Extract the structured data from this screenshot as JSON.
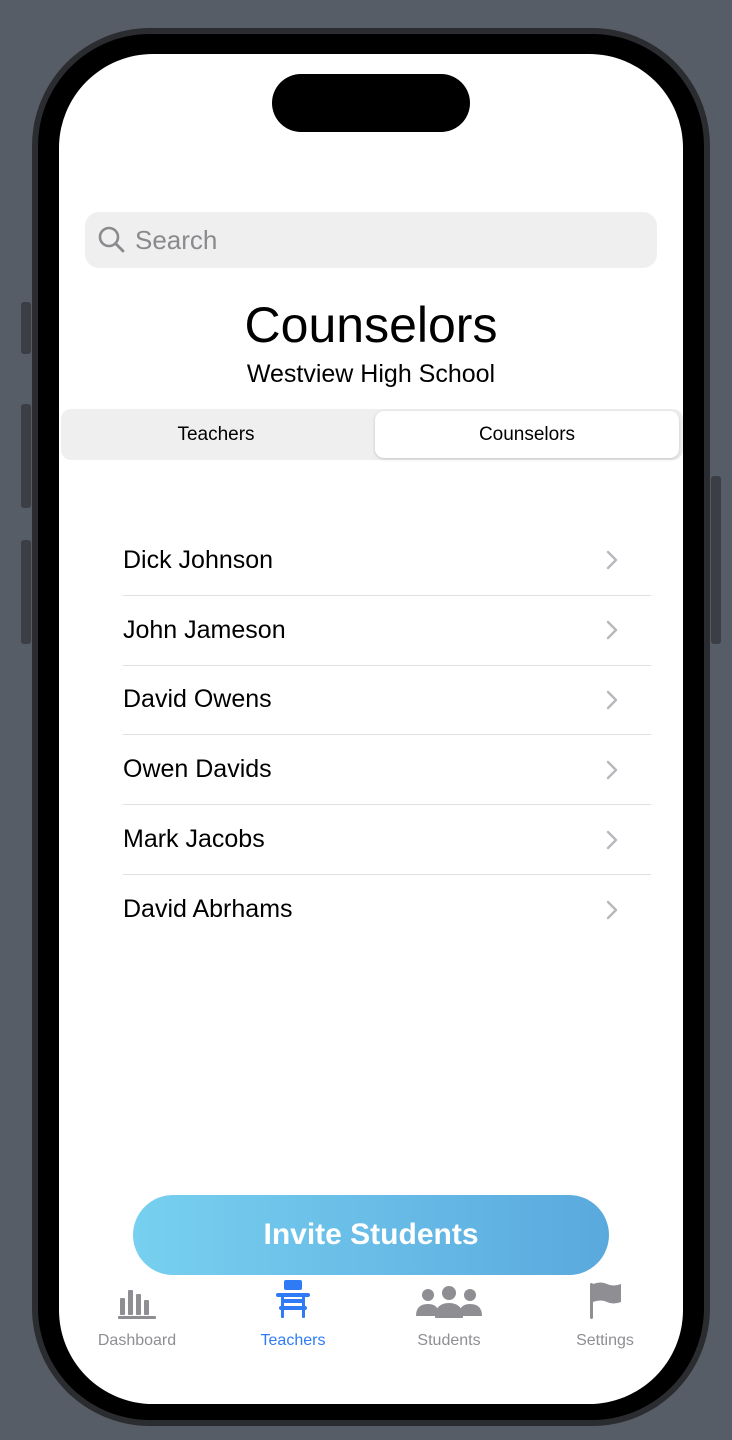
{
  "search": {
    "placeholder": "Search"
  },
  "header": {
    "title": "Counselors",
    "subtitle": "Westview High School"
  },
  "segments": [
    {
      "label": "Teachers",
      "selected": false
    },
    {
      "label": "Counselors",
      "selected": true
    }
  ],
  "people": [
    "Dick Johnson",
    "John Jameson",
    "David Owens",
    "Owen Davids",
    "Mark Jacobs",
    "David Abrhams"
  ],
  "invite_button": {
    "label": "Invite Students"
  },
  "tabbar": [
    {
      "label": "Dashboard",
      "icon": "chart-bars-icon",
      "active": false
    },
    {
      "label": "Teachers",
      "icon": "desk-chair-icon",
      "active": true
    },
    {
      "label": "Students",
      "icon": "people-icon",
      "active": false
    },
    {
      "label": "Settings",
      "icon": "flag-icon",
      "active": false
    }
  ],
  "colors": {
    "accent": "#2f7bf5",
    "inactive": "#8e8e93",
    "button_start": "#77d0ef",
    "button_end": "#5aa9de"
  }
}
